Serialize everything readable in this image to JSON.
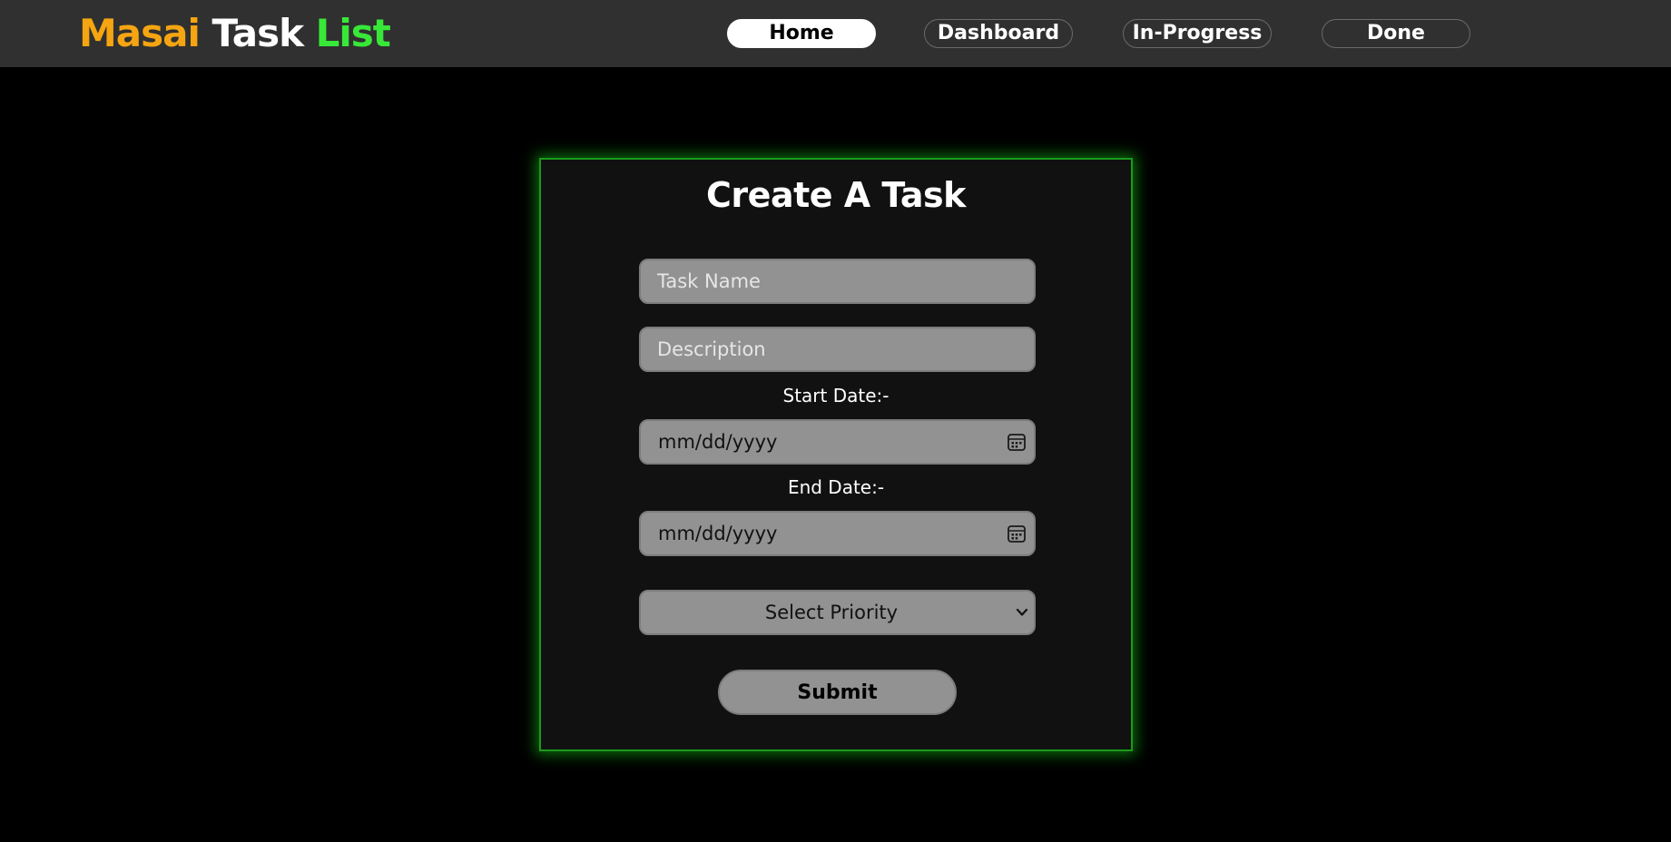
{
  "header": {
    "logo": {
      "word1": "Masai",
      "word2": "Task",
      "word3": "List"
    },
    "nav": [
      {
        "label": "Home",
        "active": true
      },
      {
        "label": "Dashboard",
        "active": false
      },
      {
        "label": "In-Progress",
        "active": false
      },
      {
        "label": "Done",
        "active": false
      }
    ]
  },
  "form": {
    "title": "Create A Task",
    "task_name_placeholder": "Task Name",
    "description_placeholder": "Description",
    "start_date_label": "Start Date:-",
    "start_date_value": "mm/dd/yyyy",
    "end_date_label": "End Date:-",
    "end_date_value": "mm/dd/yyyy",
    "priority_selected": "Select Priority",
    "submit_label": "Submit"
  },
  "colors": {
    "logo_word1": "#f5a511",
    "logo_word2": "#ffffff",
    "logo_word3": "#38e838",
    "header_bg": "#303030",
    "page_bg": "#000000",
    "card_bg": "#111111",
    "card_border_glow": "#1c9a1c",
    "input_bg": "#929292"
  },
  "icons": {
    "start_date_icon": "calendar-icon",
    "end_date_icon": "calendar-icon",
    "priority_dropdown_icon": "chevron-down-icon"
  }
}
